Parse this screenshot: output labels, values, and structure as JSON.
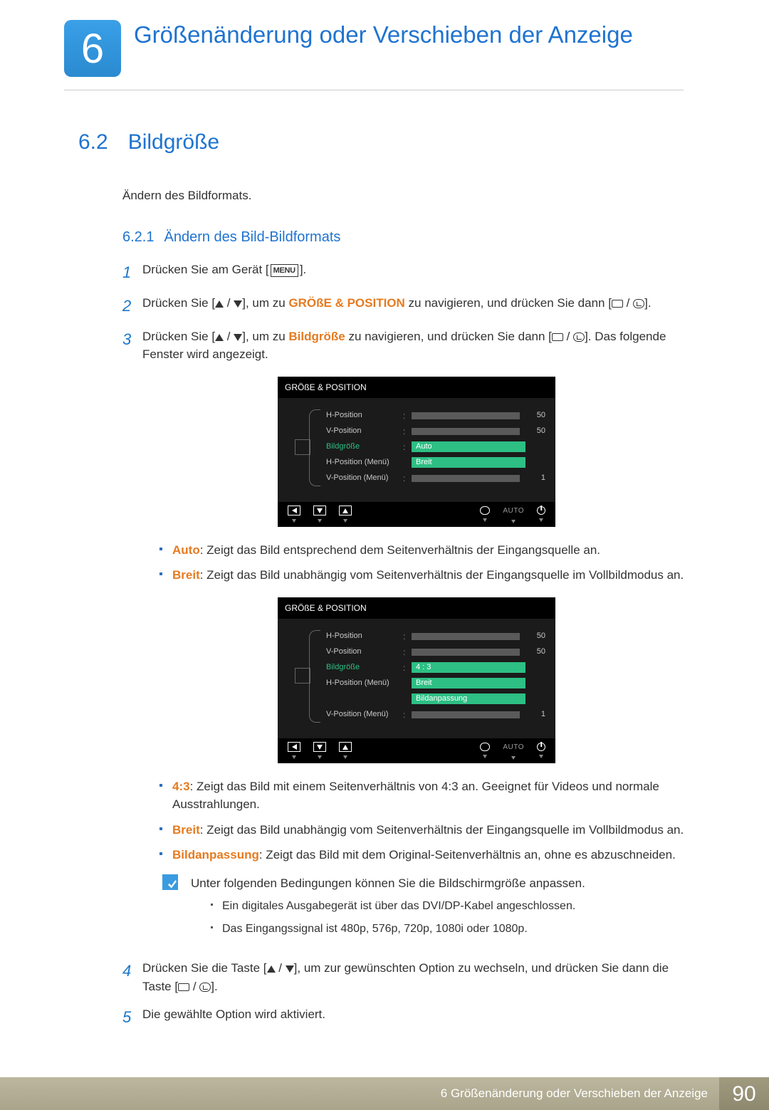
{
  "chapter": {
    "number": "6",
    "title": "Größenänderung oder Verschieben der Anzeige"
  },
  "section": {
    "number": "6.2",
    "title": "Bildgröße"
  },
  "intro": "Ändern des Bildformats.",
  "subsection": {
    "number": "6.2.1",
    "title": "Ändern des Bild-Bildformats"
  },
  "steps": {
    "1": {
      "pre": "Drücken Sie am Gerät [",
      "post": "]."
    },
    "2": {
      "pre": "Drücken Sie [",
      "mid": "], um zu ",
      "kw": "GRÖßE & POSITION",
      "mid2": " zu navigieren, und drücken Sie dann [",
      "post": "]."
    },
    "3": {
      "pre": "Drücken Sie [",
      "mid": "], um zu ",
      "kw": "Bildgröße",
      "mid2": " zu navigieren, und drücken Sie dann [",
      "post": "]. Das folgende Fenster wird angezeigt."
    },
    "4": {
      "pre": "Drücken Sie die Taste [",
      "mid": "], um zur gewünschten Option zu wechseln, und drücken Sie dann die Taste [",
      "post": "]."
    },
    "5": "Die gewählte Option wird aktiviert."
  },
  "menu_glyph": "MENU",
  "osd1": {
    "title": "GRÖßE & POSITION",
    "rows": {
      "hpos": {
        "label": "H-Position",
        "value": "50"
      },
      "vpos": {
        "label": "V-Position",
        "value": "50"
      },
      "bg": {
        "label": "Bildgröße"
      },
      "opt1": "Auto",
      "opt2": "Breit",
      "hmen": {
        "label": "H-Position (Menü)"
      },
      "vmen": {
        "label": "V-Position (Menü)",
        "value": "1"
      }
    },
    "footer_auto": "AUTO"
  },
  "osd2": {
    "title": "GRÖßE & POSITION",
    "rows": {
      "hpos": {
        "label": "H-Position",
        "value": "50"
      },
      "vpos": {
        "label": "V-Position",
        "value": "50"
      },
      "bg": {
        "label": "Bildgröße"
      },
      "opt1": "4 : 3",
      "opt2": "Breit",
      "opt3": "Bildanpassung",
      "hmen": {
        "label": "H-Position (Menü)"
      },
      "vmen": {
        "label": "V-Position (Menü)",
        "value": "1"
      }
    },
    "footer_auto": "AUTO"
  },
  "desc1": {
    "auto": {
      "term": "Auto",
      "text": ": Zeigt das Bild entsprechend dem Seitenverhältnis der Eingangsquelle an."
    },
    "breit": {
      "term": "Breit",
      "text": ": Zeigt das Bild unabhängig vom Seitenverhältnis der Eingangsquelle im Vollbildmodus an."
    }
  },
  "desc2": {
    "r43": {
      "term": "4:3",
      "text": ": Zeigt das Bild mit einem Seitenverhältnis von 4:3 an. Geeignet für Videos und normale Ausstrahlungen."
    },
    "breit": {
      "term": "Breit",
      "text": ": Zeigt das Bild unabhängig vom Seitenverhältnis der Eingangsquelle im Vollbildmodus an."
    },
    "bild": {
      "term": "Bildanpassung",
      "text": ": Zeigt das Bild mit dem Original-Seitenverhältnis an, ohne es abzuschneiden."
    }
  },
  "note": {
    "lead": "Unter folgenden Bedingungen können Sie die Bildschirmgröße anpassen.",
    "i1": "Ein digitales Ausgabegerät ist über das DVI/DP-Kabel angeschlossen.",
    "i2": "Das Eingangssignal ist 480p, 576p, 720p, 1080i oder 1080p."
  },
  "footer": {
    "text": "6 Größenänderung oder Verschieben der Anzeige",
    "page": "90"
  }
}
